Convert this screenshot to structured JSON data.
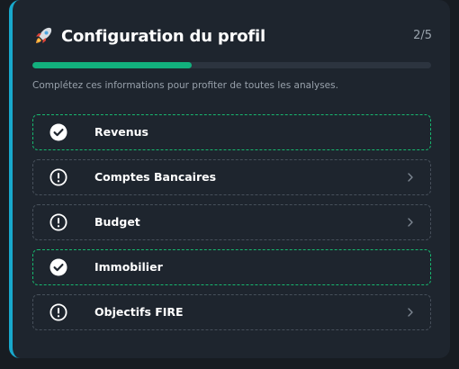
{
  "header": {
    "title": "Configuration du profil",
    "step_count": "2/5",
    "progress": 0.4,
    "subtitle": "Complétez ces informations pour profiter de toutes les analyses."
  },
  "colors": {
    "accent_bar": "#18a8cc",
    "progress_fill": "#12b07d",
    "done_border": "#17b86f",
    "pending_border": "#47505b"
  },
  "items": [
    {
      "label": "Revenus",
      "status": "done",
      "icon": "check-circle-icon"
    },
    {
      "label": "Comptes Bancaires",
      "status": "pending",
      "icon": "alert-circle-icon"
    },
    {
      "label": "Budget",
      "status": "pending",
      "icon": "alert-circle-icon"
    },
    {
      "label": "Immobilier",
      "status": "done",
      "icon": "check-circle-icon"
    },
    {
      "label": "Objectifs FIRE",
      "status": "pending",
      "icon": "alert-circle-icon"
    }
  ]
}
